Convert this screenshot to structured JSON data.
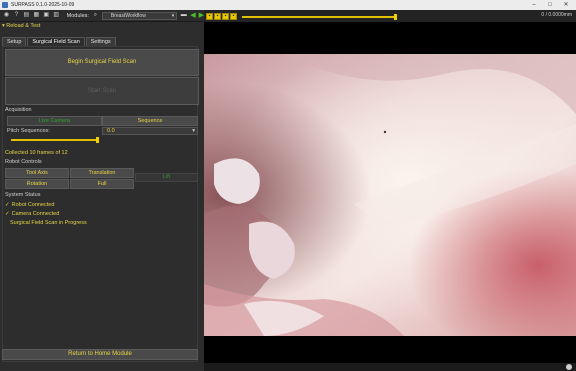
{
  "titlebar": {
    "title": "SURPASS 0.1.0-2025-10-09"
  },
  "toolbar": {
    "modules_label": "Modules:",
    "module_selected": "BreastWorkflow"
  },
  "viewer": {
    "fps_text": "0 / 0.0000mm"
  },
  "panel": {
    "header": "Reload & Test",
    "tabs": [
      "Setup",
      "Surgical Field Scan",
      "Settings"
    ],
    "begin_scan": "Begin Surgical Field Scan",
    "start_scan": "Start Scan",
    "acquisition": {
      "title": "Acquisition",
      "live_camera": "Live Camera",
      "sequence": "Sequence",
      "pitch_label": "Pitch Sequences:",
      "pitch_value": "0.0",
      "collected": "Collected 10 frames of 12"
    },
    "robot": {
      "title": "Robot Controls",
      "tool_axis": "Tool Axis",
      "translation": "Translation",
      "rotation": "Rotation",
      "full": "Full",
      "lift": "Lift"
    },
    "system": {
      "title": "System Status",
      "robot_connected": "Robot Connected",
      "camera_connected": "Camera Connected",
      "scan_progress": "Surgical Field Scan in Progress"
    },
    "home_button": "Return to Home Module"
  }
}
